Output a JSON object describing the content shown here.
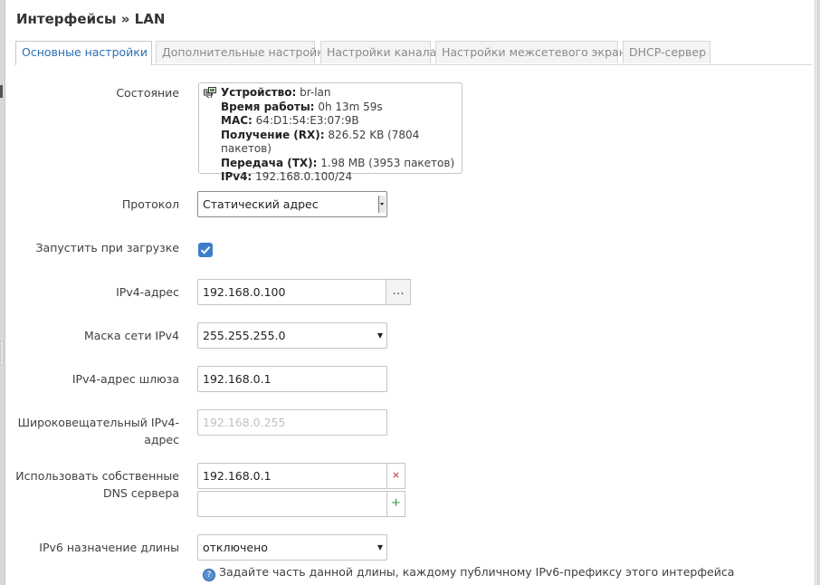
{
  "window": {
    "title": "Интерфейсы » LAN"
  },
  "tabs": [
    {
      "label": "Основные настройки",
      "active": true
    },
    {
      "label": "Дополнительные настройки",
      "active": false
    },
    {
      "label": "Настройки канала",
      "active": false
    },
    {
      "label": "Настройки межсетевого экрана",
      "active": false
    },
    {
      "label": "DHCP-сервер",
      "active": false
    }
  ],
  "status": {
    "label": "Состояние",
    "icon": "network-device-icon",
    "rows": [
      {
        "key": "Устройство:",
        "value": "br-lan"
      },
      {
        "key": "Время работы:",
        "value": "0h 13m 59s"
      },
      {
        "key": "MAC:",
        "value": "64:D1:54:E3:07:9B"
      },
      {
        "key": "Получение (RX):",
        "value": "826.52 KB (7804 пакетов)"
      },
      {
        "key": "Передача (TX):",
        "value": "1.98 MB (3953 пакетов)"
      },
      {
        "key": "IPv4:",
        "value": "192.168.0.100/24"
      }
    ]
  },
  "form": {
    "protocol": {
      "label": "Протокол",
      "value": "Статический адрес"
    },
    "autostart": {
      "label": "Запустить при загрузке",
      "checked": true
    },
    "ipv4_address": {
      "label": "IPv4-адрес",
      "value": "192.168.0.100",
      "addon": "..."
    },
    "netmask": {
      "label": "Маска сети IPv4",
      "value": "255.255.255.0"
    },
    "gateway": {
      "label": "IPv4-адрес шлюза",
      "value": "192.168.0.1"
    },
    "broadcast": {
      "label_line1": "Широковещательный IPv4-",
      "label_line2": "адрес",
      "placeholder": "192.168.0.255"
    },
    "dns": {
      "label_line1": "Использовать собственные",
      "label_line2": "DNS сервера",
      "entries": [
        "192.168.0.1"
      ],
      "remove_symbol": "×",
      "add_symbol": "+"
    },
    "ipv6_assign": {
      "label": "IPv6 назначение длины",
      "value": "отключено",
      "hint": "Задайте часть данной длины, каждому публичному IPv6-префиксу этого интерфейса"
    }
  },
  "colors": {
    "accent": "#3d7ec9",
    "tab_active_text": "#2a6fb8",
    "remove": "#cc2222",
    "add": "#3a9a3a"
  }
}
